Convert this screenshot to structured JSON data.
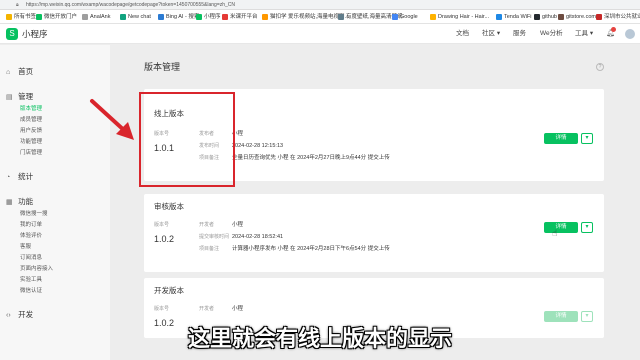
{
  "browser": {
    "url": "https://mp.weixin.qq.com/wxamp/wacodepage/getcodepage?token=1450700555&lang=zh_CN",
    "bookmarks": [
      {
        "label": "所有书签",
        "color": "#f4b400"
      },
      {
        "label": "微信开放门户",
        "color": "#07c160"
      },
      {
        "label": "AnalAnk",
        "color": "#9e9e9e"
      },
      {
        "label": "New chat",
        "color": "#10a37f"
      },
      {
        "label": "Bing AI - 搜索",
        "color": "#2b7bd3"
      },
      {
        "label": "小程序",
        "color": "#07c160"
      },
      {
        "label": "米课开平台",
        "color": "#e53935"
      },
      {
        "label": "猫扣学 爱乐视频站,海量电视剧...",
        "color": "#ff9800"
      },
      {
        "label": "有度壁纸,海量高清壁纸",
        "color": "#607d8b"
      },
      {
        "label": "Google",
        "color": "#4285f4"
      },
      {
        "label": "Drawing Hair - Hair...",
        "color": "#ffb300"
      },
      {
        "label": "Tenda WiFi",
        "color": "#1e88e5"
      },
      {
        "label": "github",
        "color": "#24292e"
      },
      {
        "label": "gitstore.com",
        "color": "#6d4c41"
      },
      {
        "label": "深圳市公共就业服...",
        "color": "#c62828"
      }
    ]
  },
  "topnav": {
    "app_name": "小程序",
    "links": [
      "文档",
      "社区",
      "服务",
      "We分析",
      "工具"
    ]
  },
  "sidebar": {
    "groups": [
      {
        "label": "首页",
        "icon": "home-icon",
        "glyph": "⌂",
        "items": []
      },
      {
        "label": "管理",
        "icon": "manage-icon",
        "glyph": "▤",
        "items": [
          "版本管理",
          "成员管理",
          "用户反馈",
          "功能管理",
          "门店管理"
        ]
      },
      {
        "label": "统计",
        "icon": "stats-icon",
        "glyph": "◔",
        "items": []
      },
      {
        "label": "功能",
        "icon": "features-icon",
        "glyph": "▦",
        "items": [
          "微信搜一搜",
          "我的订单",
          "体验评价",
          "客服",
          "订阅消息",
          "页面内容接入",
          "实验工具",
          "微信认证"
        ]
      },
      {
        "label": "开发",
        "icon": "dev-icon",
        "glyph": "‹›",
        "items": []
      }
    ]
  },
  "page": {
    "title": "版本管理"
  },
  "cards": [
    {
      "title": "线上版本",
      "version_label": "版本号",
      "version": "1.0.1",
      "rows": [
        {
          "label": "发布者",
          "value": "小程"
        },
        {
          "label": "发布时间",
          "value": "2024-02-28 12:15:13"
        },
        {
          "label": "项目备注",
          "value": "全量日历查询优先 小程 在 2024年2月27日晚上9点44分 提交上传"
        }
      ],
      "button": "详情",
      "disabled": false
    },
    {
      "title": "审核版本",
      "version_label": "版本号",
      "version": "1.0.2",
      "rows": [
        {
          "label": "开发者",
          "value": "小程"
        },
        {
          "label": "提交审核时间",
          "value": "2024-02-28 18:52:41"
        },
        {
          "label": "项目备注",
          "value": "计算器小程序发布 小程 在 2024年2月28日下午6点54分 提交上传"
        }
      ],
      "button": "详情",
      "disabled": false
    },
    {
      "title": "开发版本",
      "version_label": "版本号",
      "version": "1.0.2",
      "rows": [
        {
          "label": "开发者",
          "value": "小程"
        }
      ],
      "button": "详情",
      "disabled": true
    }
  ],
  "subtitle": "这里就会有线上版本的显示",
  "colors": {
    "accent": "#07c160",
    "highlight": "#d9252c"
  }
}
